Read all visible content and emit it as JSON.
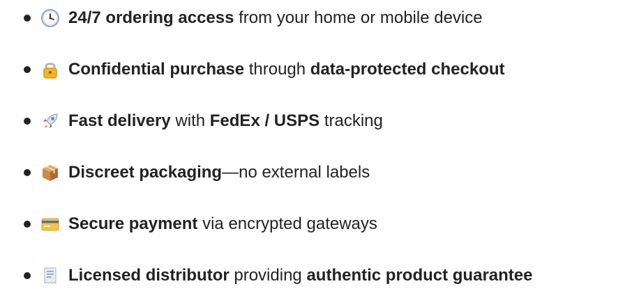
{
  "items": [
    {
      "icon": "clock-icon",
      "parts": [
        "24/7 ordering access",
        " from your home or mobile device"
      ]
    },
    {
      "icon": "lock-icon",
      "parts": [
        "Confidential purchase",
        " through ",
        "data-protected checkout"
      ]
    },
    {
      "icon": "rocket-icon",
      "parts": [
        "Fast delivery",
        " with ",
        "FedEx / USPS",
        " tracking"
      ]
    },
    {
      "icon": "package-icon",
      "parts": [
        "Discreet packaging",
        "—no external labels"
      ]
    },
    {
      "icon": "credit-card-icon",
      "parts": [
        "Secure payment",
        " via encrypted gateways"
      ]
    },
    {
      "icon": "receipt-icon",
      "parts": [
        "Licensed distributor",
        " providing ",
        "authentic product guarantee"
      ]
    }
  ],
  "colors": {
    "text": "#222222",
    "clock_face": "#DCE7F3",
    "lock_body": "#F6B51E",
    "rocket": "#D64541",
    "package": "#C78A4D",
    "card": "#F6C443",
    "receipt": "#E8EDF3"
  }
}
